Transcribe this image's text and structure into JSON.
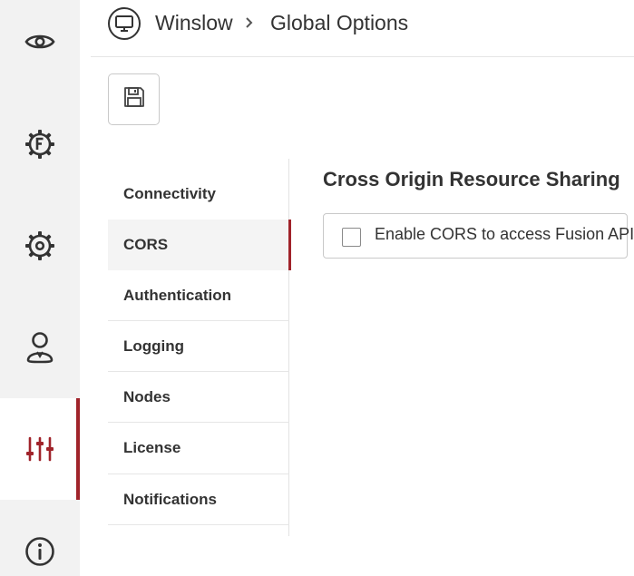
{
  "colors": {
    "accent": "#a0232a",
    "rail_bg": "#f2f2f2",
    "text": "#333333"
  },
  "rail": {
    "items": [
      {
        "name": "eye-icon",
        "active": false
      },
      {
        "name": "fusion-gear-icon",
        "active": false
      },
      {
        "name": "gear-icon",
        "active": false
      },
      {
        "name": "user-icon",
        "active": false
      },
      {
        "name": "sliders-icon",
        "active": true
      },
      {
        "name": "info-icon",
        "active": false
      }
    ]
  },
  "header": {
    "app_icon": "monitor-icon",
    "breadcrumb": [
      "Winslow",
      "Global Options"
    ],
    "separator_icon": "chevron-right-icon"
  },
  "toolbar": {
    "save_icon": "save-icon"
  },
  "nav": {
    "items": [
      {
        "label": "Connectivity",
        "active": false
      },
      {
        "label": "CORS",
        "active": true
      },
      {
        "label": "Authentication",
        "active": false
      },
      {
        "label": "Logging",
        "active": false
      },
      {
        "label": "Nodes",
        "active": false
      },
      {
        "label": "License",
        "active": false
      },
      {
        "label": "Notifications",
        "active": false
      }
    ]
  },
  "content": {
    "title": "Cross Origin Resource Sharing",
    "cors_checkbox": {
      "label": "Enable CORS to access Fusion API",
      "checked": false
    }
  }
}
